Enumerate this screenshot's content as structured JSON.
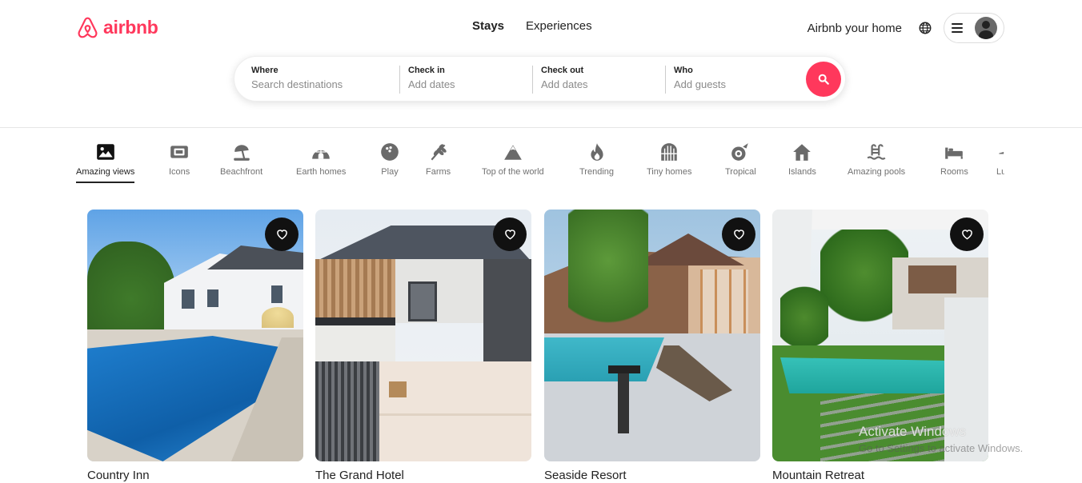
{
  "brand": {
    "name": "airbnb",
    "color": "#ff385c"
  },
  "nav": {
    "tabs": [
      {
        "label": "Stays"
      },
      {
        "label": "Experiences"
      }
    ]
  },
  "actions": {
    "host_label": "Airbnb your home",
    "globe_icon": "globe-icon",
    "menu_icon": "hamburger-icon",
    "avatar_icon": "user-avatar-icon"
  },
  "search": {
    "fields": [
      {
        "label": "Where",
        "placeholder": "Search destinations"
      },
      {
        "label": "Check in",
        "placeholder": "Add dates"
      },
      {
        "label": "Check out",
        "placeholder": "Add dates"
      },
      {
        "label": "Who",
        "placeholder": "Add guests"
      }
    ],
    "button_icon": "search-icon"
  },
  "categories": [
    {
      "label": "Amazing views",
      "icon": "picture-icon",
      "active": true
    },
    {
      "label": "Icons",
      "icon": "ticket-icon"
    },
    {
      "label": "Beachfront",
      "icon": "umbrella-icon"
    },
    {
      "label": "Earth homes",
      "icon": "igloo-icon"
    },
    {
      "label": "Play",
      "icon": "bowling-ball-icon"
    },
    {
      "label": "Farms",
      "icon": "wheat-icon"
    },
    {
      "label": "Top of the world",
      "icon": "mountain-icon"
    },
    {
      "label": "Trending",
      "icon": "fire-icon"
    },
    {
      "label": "Tiny homes",
      "icon": "gate-icon"
    },
    {
      "label": "Tropical",
      "icon": "comet-icon"
    },
    {
      "label": "Islands",
      "icon": "house-icon"
    },
    {
      "label": "Amazing pools",
      "icon": "pool-ladder-icon"
    },
    {
      "label": "Rooms",
      "icon": "bed-icon"
    },
    {
      "label": "Lu",
      "icon": "partial-icon"
    }
  ],
  "listings": [
    {
      "title": "Country Inn",
      "heart_icon": "heart-icon"
    },
    {
      "title": "The Grand Hotel",
      "heart_icon": "heart-icon"
    },
    {
      "title": "Seaside Resort",
      "heart_icon": "heart-icon"
    },
    {
      "title": "Mountain Retreat",
      "heart_icon": "heart-icon"
    }
  ],
  "watermark": {
    "line1": "Activate Windows",
    "line2": "Go to Settings to activate Windows."
  }
}
